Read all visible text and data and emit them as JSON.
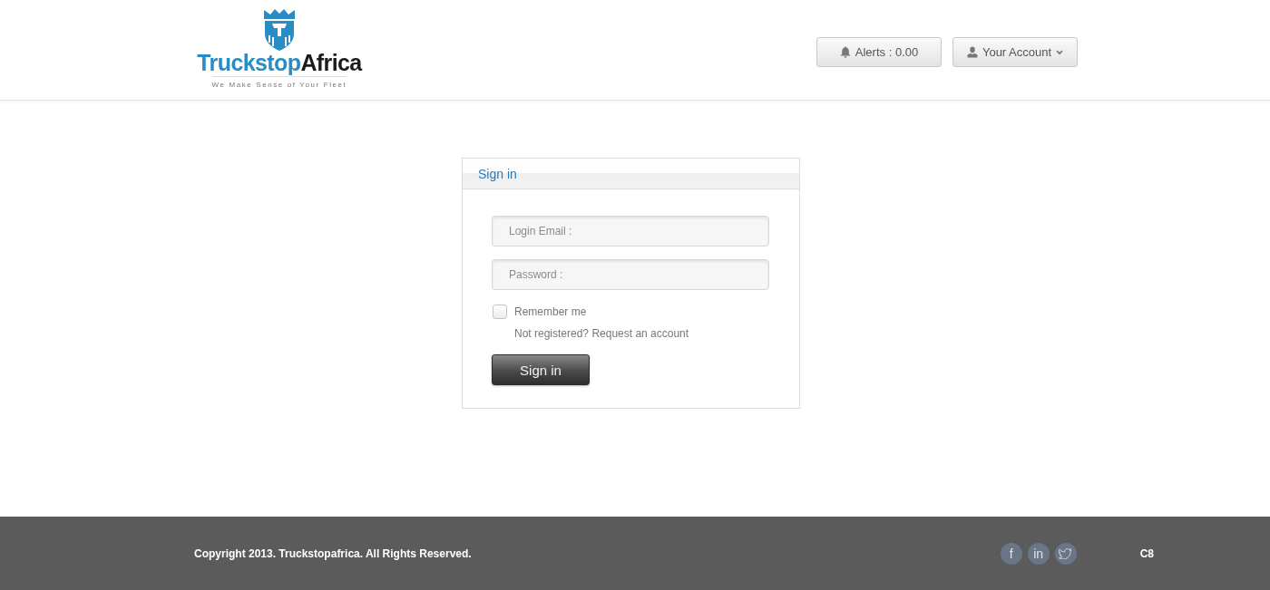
{
  "header": {
    "logo": {
      "wordmark": [
        {
          "text": "Truckstop",
          "color": "#2a8cc4"
        },
        {
          "text": "Africa",
          "color": "#1b1b1b"
        }
      ],
      "tagline": "We Make Sense of Your Fleet"
    },
    "buttons": [
      {
        "kind": "alerts",
        "label": "Alerts : 0.00"
      },
      {
        "kind": "account",
        "label": "Your Account"
      }
    ]
  },
  "signin_panel": {
    "title": "Sign in",
    "email_field": {
      "placeholder": "Login Email :"
    },
    "password_field": {
      "placeholder": "Password :"
    },
    "remember": {
      "label": "Remember me",
      "checked": false
    },
    "register_prompt": "Not registered? Request an account",
    "submit": "Sign in"
  },
  "footer": {
    "copyright": "Copyright 2013. Truckstopafrica. All Rights Reserved.",
    "social": [
      {
        "kind": "facebook",
        "glyph": "f"
      },
      {
        "kind": "linkedin",
        "glyph": "in"
      },
      {
        "kind": "twitter"
      }
    ],
    "code": "C8"
  }
}
